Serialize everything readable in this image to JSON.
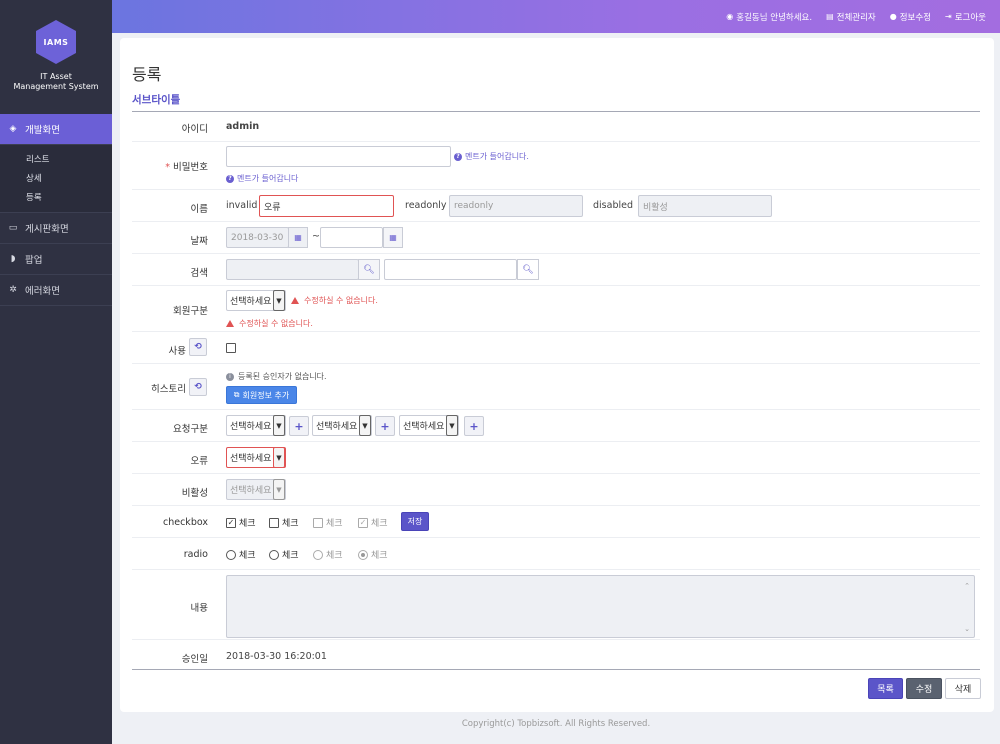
{
  "brand": {
    "logo": "IAMS",
    "line1": "IT Asset",
    "line2": "Management System"
  },
  "nav": {
    "items": [
      {
        "label": "개발화면",
        "icon": "diamond-icon"
      },
      {
        "label": "게시판화면",
        "icon": "monitor-icon"
      },
      {
        "label": "팝업",
        "icon": "shield-icon"
      },
      {
        "label": "에러화면",
        "icon": "gear-icon"
      }
    ],
    "sub": [
      "리스트",
      "상세",
      "등록"
    ]
  },
  "topbar": {
    "user": "홍길동님 안녕하세요.",
    "admin": "전체관리자",
    "profile": "정보수정",
    "logout": "로그아웃"
  },
  "page": {
    "title": "등록",
    "subtitle": "서브타이틀"
  },
  "form": {
    "id": {
      "label": "아이디",
      "value": "admin"
    },
    "password": {
      "label": "비밀번호",
      "hint1": "멘트가 들어갑니다.",
      "hint2": "멘트가 들어갑니다"
    },
    "name": {
      "label": "이름",
      "invalid_label": "invalid",
      "invalid_value": "오류",
      "readonly_label": "readonly",
      "readonly_value": "readonly",
      "disabled_label": "disabled",
      "disabled_value": "비활성"
    },
    "date": {
      "label": "날짜",
      "from": "2018-03-30",
      "sep": "~",
      "to": ""
    },
    "search": {
      "label": "검색"
    },
    "member": {
      "label": "회원구분",
      "select": "선택하세요",
      "warn1": "수정하실 수 없습니다.",
      "warn2": "수정하실 수 없습니다."
    },
    "use": {
      "label": "사용"
    },
    "history": {
      "label": "히스토리",
      "note": "등록된 승인자가 없습니다.",
      "button": "회원정보 추가"
    },
    "request": {
      "label": "요청구분",
      "selects": [
        "선택하세요",
        "선택하세요",
        "선택하세요"
      ]
    },
    "error": {
      "label": "오류",
      "select": "선택하세요"
    },
    "disabled": {
      "label": "비활성",
      "select": "선택하세요"
    },
    "checkbox": {
      "label": "checkbox",
      "items": [
        "체크",
        "체크",
        "체크",
        "체크"
      ],
      "save": "저장"
    },
    "radio": {
      "label": "radio",
      "items": [
        "체크",
        "체크",
        "체크",
        "체크"
      ]
    },
    "content": {
      "label": "내용",
      "value": ""
    },
    "approved": {
      "label": "승인일",
      "value": "2018-03-30 16:20:01"
    }
  },
  "actions": {
    "list": "목록",
    "edit": "수정",
    "delete": "삭제"
  },
  "footer": "Copyright(c) Topbizsoft. All Rights Reserved.",
  "colors": {
    "accent": "#5b55c9",
    "sidebar": "#2f3142",
    "error": "#e05353"
  }
}
